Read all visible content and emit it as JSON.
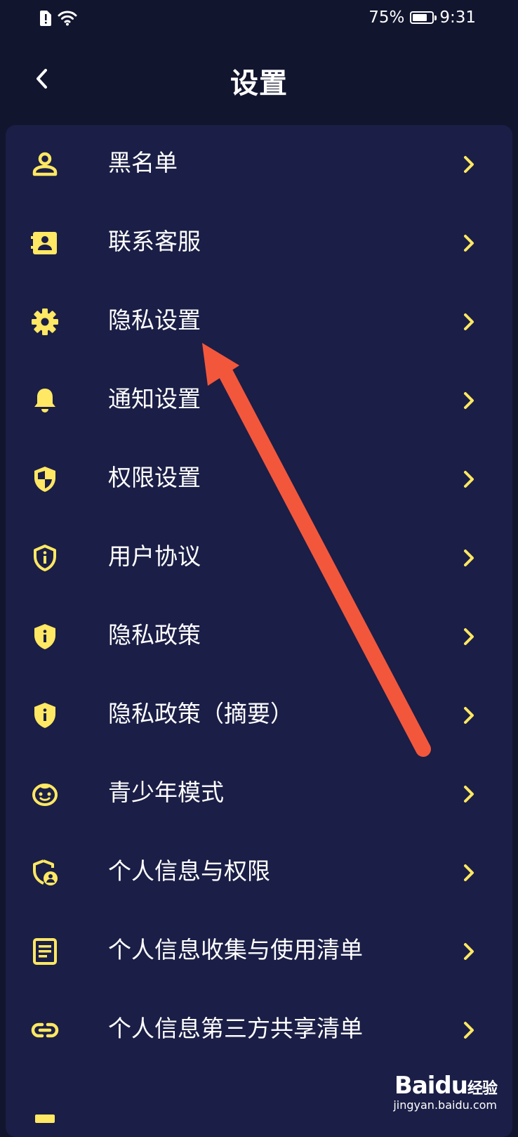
{
  "status_bar": {
    "battery": "75%",
    "battery_level": 0.75,
    "time": "9:31"
  },
  "header": {
    "title": "设置",
    "back_icon": "back-chevron-icon"
  },
  "colors": {
    "background": "#12152e",
    "card": "#1b1e46",
    "icon_accent": "#ffe863",
    "arrow": "#f2573c"
  },
  "menu": {
    "items": [
      {
        "label": "黑名单",
        "icon": "person-icon"
      },
      {
        "label": "联系客服",
        "icon": "contact-card-icon"
      },
      {
        "label": "隐私设置",
        "icon": "gear-icon"
      },
      {
        "label": "通知设置",
        "icon": "bell-icon"
      },
      {
        "label": "权限设置",
        "icon": "shield-half-icon"
      },
      {
        "label": "用户协议",
        "icon": "shield-info-outline-icon"
      },
      {
        "label": "隐私政策",
        "icon": "shield-info-icon"
      },
      {
        "label": "隐私政策（摘要）",
        "icon": "shield-info-icon"
      },
      {
        "label": "青少年模式",
        "icon": "child-face-icon"
      },
      {
        "label": "个人信息与权限",
        "icon": "shield-person-icon"
      },
      {
        "label": "个人信息收集与使用清单",
        "icon": "document-list-icon"
      },
      {
        "label": "个人信息第三方共享清单",
        "icon": "link-icon"
      }
    ]
  },
  "watermark": {
    "logo": "Baidu",
    "suffix": "经验",
    "site": "jingyan.baidu.com"
  }
}
